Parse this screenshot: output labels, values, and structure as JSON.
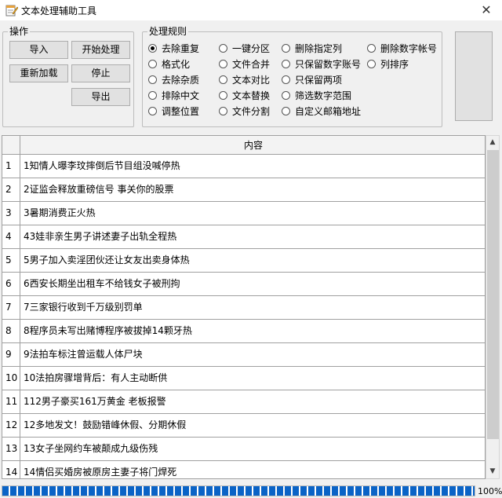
{
  "window": {
    "title": "文本处理辅助工具",
    "close": "✕"
  },
  "ops": {
    "legend": "操作",
    "import": "导入",
    "start": "开始处理",
    "reload": "重新加载",
    "stop": "停止",
    "export": "导出"
  },
  "rules": {
    "legend": "处理规则",
    "options": [
      {
        "label": "去除重复",
        "checked": true
      },
      {
        "label": "格式化",
        "checked": false
      },
      {
        "label": "去除杂质",
        "checked": false
      },
      {
        "label": "排除中文",
        "checked": false
      },
      {
        "label": "调整位置",
        "checked": false
      },
      {
        "label": "一键分区",
        "checked": false
      },
      {
        "label": "文件合并",
        "checked": false
      },
      {
        "label": "文本对比",
        "checked": false
      },
      {
        "label": "文本替换",
        "checked": false
      },
      {
        "label": "文件分割",
        "checked": false
      },
      {
        "label": "删除指定列",
        "checked": false
      },
      {
        "label": "只保留数字账号",
        "checked": false
      },
      {
        "label": "只保留两项",
        "checked": false
      },
      {
        "label": "筛选数字范围",
        "checked": false
      },
      {
        "label": "自定义邮箱地址",
        "checked": false
      },
      {
        "label": "删除数字帐号",
        "checked": false
      },
      {
        "label": "列排序",
        "checked": false
      }
    ]
  },
  "grid": {
    "header": "内容",
    "rows": [
      {
        "n": "1",
        "text": "1知情人曝李玟摔倒后节目组没喊停热"
      },
      {
        "n": "2",
        "text": "2证监会释放重磅信号 事关你的股票"
      },
      {
        "n": "3",
        "text": "3暑期消费正火热"
      },
      {
        "n": "4",
        "text": "43娃非亲生男子讲述妻子出轨全程热"
      },
      {
        "n": "5",
        "text": "5男子加入卖淫团伙还让女友出卖身体热"
      },
      {
        "n": "6",
        "text": "6西安长期坐出租车不给钱女子被刑拘"
      },
      {
        "n": "7",
        "text": "7三家银行收到千万级别罚单"
      },
      {
        "n": "8",
        "text": "8程序员未写出赌博程序被拔掉14颗牙热"
      },
      {
        "n": "9",
        "text": "9法拍车标注曾运载人体尸块"
      },
      {
        "n": "10",
        "text": "10法拍房骤增背后：有人主动断供"
      },
      {
        "n": "11",
        "text": "112男子豪买161万黄金 老板报警"
      },
      {
        "n": "12",
        "text": "12多地发文！鼓励错峰休假、分期休假"
      },
      {
        "n": "13",
        "text": "13女子坐网约车被颠成九级伤残"
      },
      {
        "n": "14",
        "text": "14情侣买婚房被原房主妻子将门焊死"
      }
    ]
  },
  "scrollbar": {
    "up": "▲",
    "down": "▼"
  },
  "progress": {
    "value": 100,
    "label": "100%"
  }
}
